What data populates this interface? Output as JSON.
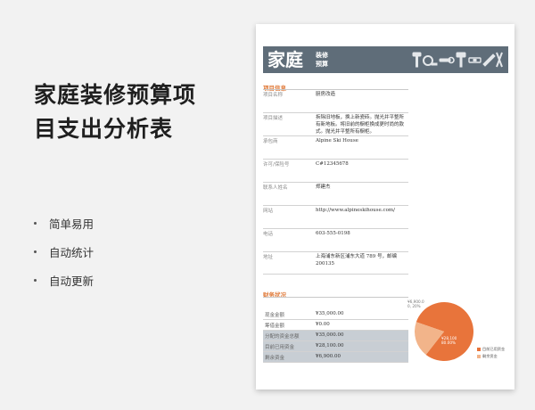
{
  "page": {
    "title_line1": "家庭装修预算项",
    "title_line2": "目支出分析表",
    "bullets": [
      "简单易用",
      "自动统计",
      "自动更新"
    ]
  },
  "banner": {
    "big": "家庭",
    "small_line1": "装修",
    "small_line2": "预算",
    "icons": [
      "hammer-icon",
      "tape-measure-icon",
      "wrench-icon",
      "paint-roller-icon",
      "level-icon",
      "saw-icon",
      "pliers-icon"
    ]
  },
  "project_info": {
    "heading": "项目信息",
    "rows": [
      {
        "label": "项目名称",
        "value": "厨房改造"
      },
      {
        "label": "项目描述",
        "value": "拆除旧地板，换上新瓷砖。抛光并平整所有新地板。将旧前的橱柜换成更时尚的款式。抛光并平整所有橱柜。"
      },
      {
        "label": "承包商",
        "value": "Alpine Ski House"
      },
      {
        "label": "许可/保险号",
        "value": "C#12345678"
      },
      {
        "label": "联系人姓名",
        "value": "郑建杰"
      },
      {
        "label": "网站",
        "value": "http://www.alpineskihouse.com/"
      },
      {
        "label": "电话",
        "value": "603-555-0198"
      },
      {
        "label": "地址",
        "value": "上海浦东新区浦东大道 789 号，邮编 200135"
      }
    ]
  },
  "financial": {
    "heading": "财务状况",
    "rows": [
      {
        "label": "现金金额",
        "value": "¥35,000.00",
        "shaded": false
      },
      {
        "label": "筹借金额",
        "value": "¥0.00",
        "shaded": false
      },
      {
        "label": "分配的资金总额",
        "value": "¥35,000.00",
        "shaded": true
      },
      {
        "label": "目前已用资金",
        "value": "¥28,100.00",
        "shaded": true
      },
      {
        "label": "剩余资金",
        "value": "¥6,900.00",
        "shaded": true
      }
    ]
  },
  "chart_data": {
    "type": "pie",
    "slices": [
      {
        "name": "目前已用资金",
        "value": 28100,
        "label_value": "¥28,100",
        "label_pct": "80.00%",
        "color": "#e8743b"
      },
      {
        "name": "剩余资金",
        "value": 6900,
        "label_value": "¥6,900.0",
        "label_pct": "0, 20%",
        "color": "#f2b48a"
      }
    ],
    "legend_position": "right"
  }
}
